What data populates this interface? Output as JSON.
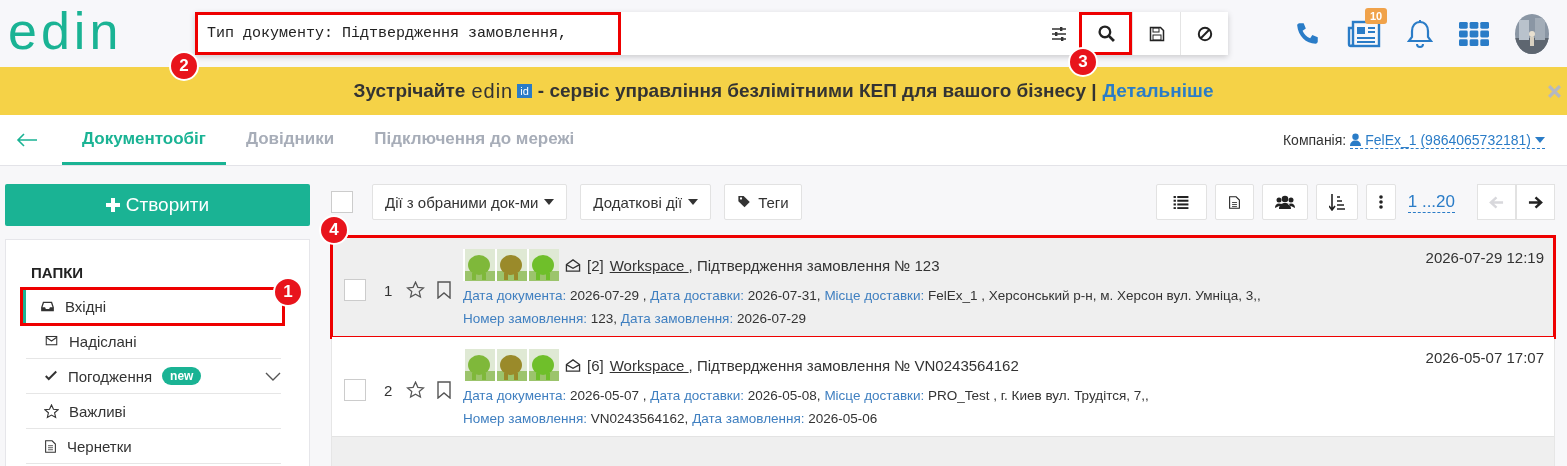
{
  "header": {
    "logo": "edin",
    "search": {
      "value": "Тип документу: Підтвердження замовлення,",
      "annotation": "2"
    },
    "search_button": {
      "annotation": "3"
    },
    "notifications_badge": "10"
  },
  "banner": {
    "lead": "Зустрічайте",
    "logo": "edin",
    "logo_badge": "id",
    "text": "- сервіс управління безлімітними КЕП для вашого бізнесу |",
    "link": "Детальніше"
  },
  "tabs": [
    {
      "label": "Документообіг",
      "selected": true
    },
    {
      "label": "Довідники",
      "selected": false
    },
    {
      "label": "Підключення до мережі",
      "selected": false
    }
  ],
  "company": {
    "label": "Компанія:",
    "value": "FelEx_1 (9864065732181)"
  },
  "sidebar": {
    "create_button": "Створити",
    "heading": "ПАПКИ",
    "items": [
      {
        "label": "Вхідні",
        "selected": true,
        "annotation": "1"
      },
      {
        "label": "Надіслані",
        "selected": false
      },
      {
        "label": "Погодження",
        "selected": false,
        "badge": "new",
        "expandable": true
      },
      {
        "label": "Важливі",
        "selected": false
      },
      {
        "label": "Чернетки",
        "selected": false
      }
    ]
  },
  "toolbar": {
    "actions": [
      {
        "label": "Дії з обраними док-ми",
        "kind": "dropdown"
      },
      {
        "label": "Додаткові дії",
        "kind": "dropdown"
      },
      {
        "label": "Теги",
        "kind": "tag"
      }
    ],
    "pagination": "1 ...20",
    "prev_disabled": true,
    "select_all_checked": false
  },
  "documents": [
    {
      "number": "1",
      "checked": false,
      "count": "[2]",
      "sender": "Workspace ",
      "subject": ", Підтвердження замовлення № 123",
      "date": "2026-07-29 12:19",
      "highlighted": true,
      "annotation": "4",
      "thumbnails": [
        {
          "kind": "picture"
        },
        {
          "kind": "picture"
        },
        {
          "kind": "picture"
        }
      ],
      "lines": [
        [
          {
            "label": "Дата документа:",
            "value": "2026-07-29 ,"
          },
          {
            "label": "Дата доставки:",
            "value": "2026-07-31,"
          },
          {
            "label": "Місце доставки:",
            "value": "FelEx_1 , Херсонський р-н, м. Херсон вул. Умніца, 3,,"
          }
        ],
        [
          {
            "label": "Номер замовлення:",
            "value": "123,"
          },
          {
            "label": "Дата замовлення:",
            "value": "2026-07-29"
          }
        ]
      ]
    },
    {
      "number": "2",
      "checked": false,
      "count": "[6]",
      "sender": "Workspace ",
      "subject": ", Підтвердження замовлення № VN0243564162",
      "date": "2026-05-07 17:07",
      "highlighted": false,
      "thumbnails": [
        {
          "kind": "picture"
        },
        {
          "kind": "picture"
        },
        {
          "kind": "picture"
        }
      ],
      "lines": [
        [
          {
            "label": "Дата документа:",
            "value": "2026-05-07 ,"
          },
          {
            "label": "Дата доставки:",
            "value": "2026-05-08,"
          },
          {
            "label": "Місце доставки:",
            "value": "PRO_Test , г. Киев вул. Трудітся, 7,,"
          }
        ],
        [
          {
            "label": "Номер замовлення:",
            "value": "VN0243564162,"
          },
          {
            "label": "Дата замовлення:",
            "value": "2026-05-06"
          }
        ]
      ]
    }
  ]
}
